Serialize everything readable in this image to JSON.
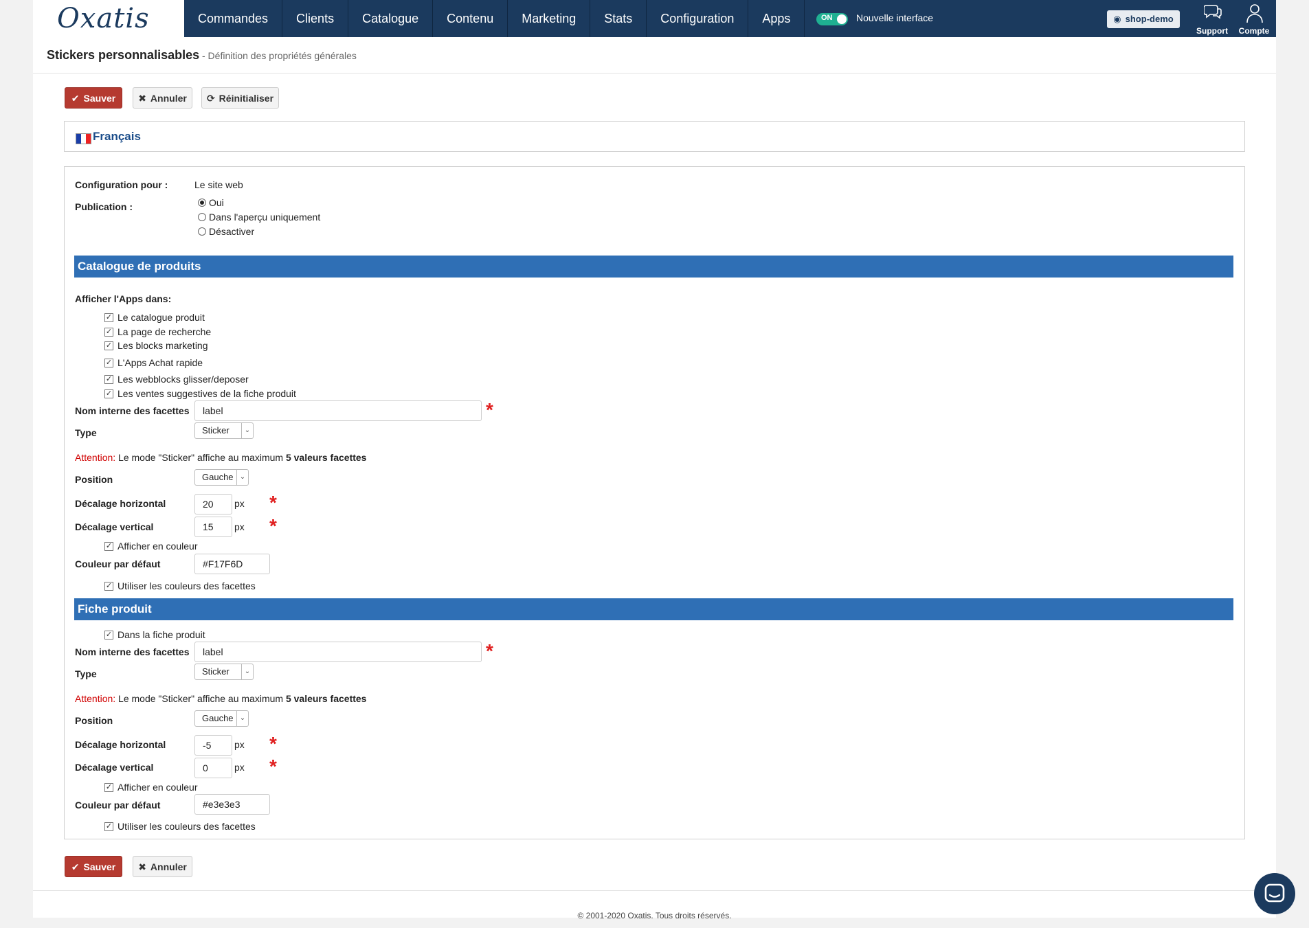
{
  "logo": "Oxatis",
  "nav": [
    "Commandes",
    "Clients",
    "Catalogue",
    "Contenu",
    "Marketing",
    "Stats",
    "Configuration",
    "Apps"
  ],
  "toggle": {
    "state": "ON",
    "label": "Nouvelle interface"
  },
  "shop": "shop-demo",
  "top_icons": {
    "support": "Support",
    "compte": "Compte"
  },
  "page": {
    "title": "Stickers personnalisables",
    "subtitle": "- Définition des propriétés générales"
  },
  "buttons": {
    "save": "Sauver",
    "cancel": "Annuler",
    "reset": "Réinitialiser"
  },
  "language": "Français",
  "config": {
    "label": "Configuration pour :",
    "value": "Le site web"
  },
  "publication": {
    "label": "Publication :",
    "options": [
      "Oui",
      "Dans l'aperçu uniquement",
      "Désactiver"
    ],
    "selected": "Oui"
  },
  "catalogue": {
    "header": "Catalogue de produits",
    "afficher_label": "Afficher l'Apps dans:",
    "checks": [
      "Le catalogue produit",
      "La page de recherche",
      "Les blocks marketing",
      "L'Apps Achat rapide",
      "Les webblocks glisser/deposer",
      "Les ventes suggestives de la fiche produit"
    ],
    "nom_label": "Nom interne des facettes",
    "nom_value": "label",
    "type_label": "Type",
    "type_value": "Sticker",
    "warn_prefix": "Attention:",
    "warn_text": " Le mode \"Sticker\" affiche au maximum ",
    "warn_bold": "5 valeurs facettes",
    "position_label": "Position",
    "position_value": "Gauche",
    "dh_label": "Décalage horizontal",
    "dh_value": "20",
    "dv_label": "Décalage vertical",
    "dv_value": "15",
    "unit": "px",
    "color_check": "Afficher en couleur",
    "couleur_label": "Couleur par défaut",
    "couleur_value": "#F17F6D",
    "use_colors": "Utiliser les couleurs des facettes"
  },
  "fiche": {
    "header": "Fiche produit",
    "dans_check": "Dans la fiche produit",
    "nom_label": "Nom interne des facettes",
    "nom_value": "label",
    "type_label": "Type",
    "type_value": "Sticker",
    "warn_prefix": "Attention:",
    "warn_text": " Le mode \"Sticker\" affiche au maximum ",
    "warn_bold": "5 valeurs facettes",
    "position_label": "Position",
    "position_value": "Gauche",
    "dh_label": "Décalage horizontal",
    "dh_value": "-5",
    "dv_label": "Décalage vertical",
    "dv_value": "0",
    "unit": "px",
    "color_check": "Afficher en couleur",
    "couleur_label": "Couleur par défaut",
    "couleur_value": "#e3e3e3",
    "use_colors": "Utiliser les couleurs des facettes"
  },
  "required_mark": "*",
  "footer": "© 2001-2020 Oxatis. Tous droits réservés.",
  "colors": {
    "nav_bg": "#1b3a5e",
    "section_bg": "#2f6fb5",
    "save_btn": "#b53a30",
    "toggle_on": "#1fb092",
    "required": "#e02020"
  }
}
